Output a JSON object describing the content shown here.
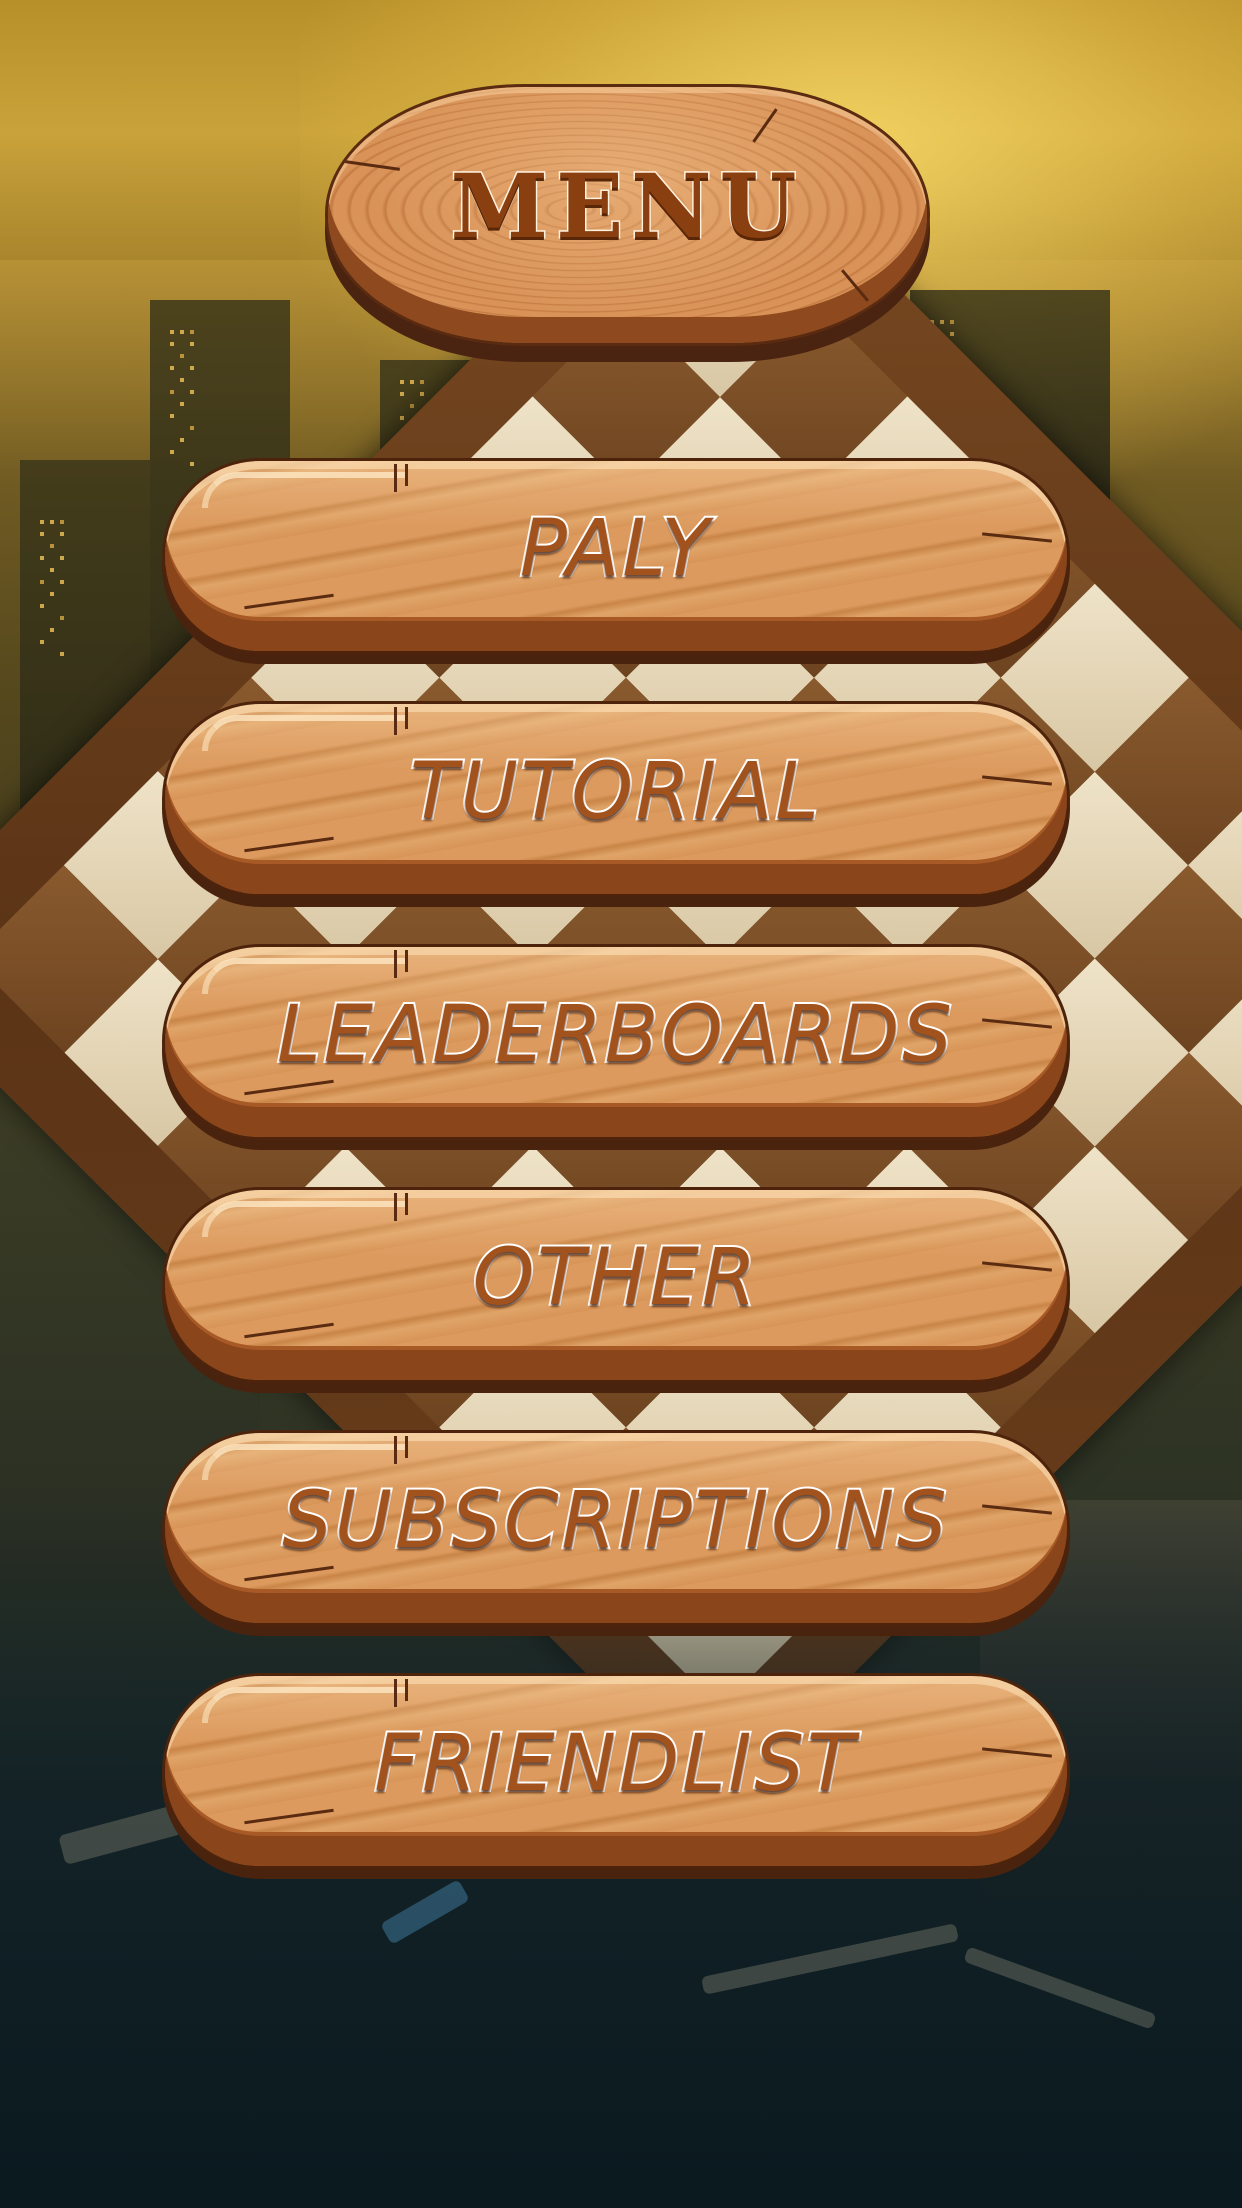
{
  "menu": {
    "title": "MENU"
  },
  "buttons": [
    {
      "label": "PALY"
    },
    {
      "label": "TUTORIAL"
    },
    {
      "label": "LEADERBOARDS"
    },
    {
      "label": "OTHER"
    },
    {
      "label": "SUBSCRIPTIONS"
    },
    {
      "label": "FRIENDLIST"
    }
  ],
  "colors": {
    "wood_light": "#d6925a",
    "wood_dark": "#8b451b",
    "outline": "#4d230c",
    "label_fill": "#a2521c",
    "label_stroke": "#ffffff",
    "title_fill": "#8a3f10"
  }
}
